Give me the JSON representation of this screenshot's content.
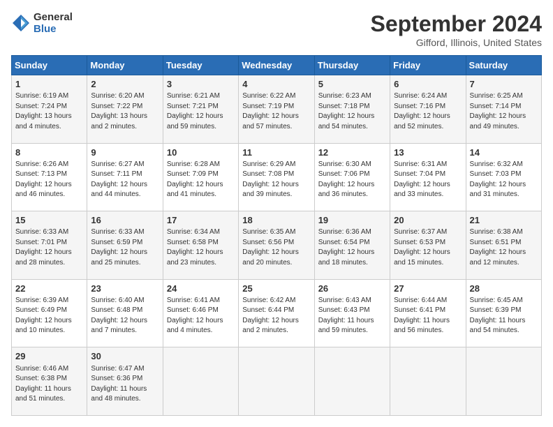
{
  "header": {
    "logo_line1": "General",
    "logo_line2": "Blue",
    "main_title": "September 2024",
    "subtitle": "Gifford, Illinois, United States"
  },
  "columns": [
    "Sunday",
    "Monday",
    "Tuesday",
    "Wednesday",
    "Thursday",
    "Friday",
    "Saturday"
  ],
  "weeks": [
    [
      {
        "day": "1",
        "info": "Sunrise: 6:19 AM\nSunset: 7:24 PM\nDaylight: 13 hours\nand 4 minutes."
      },
      {
        "day": "2",
        "info": "Sunrise: 6:20 AM\nSunset: 7:22 PM\nDaylight: 13 hours\nand 2 minutes."
      },
      {
        "day": "3",
        "info": "Sunrise: 6:21 AM\nSunset: 7:21 PM\nDaylight: 12 hours\nand 59 minutes."
      },
      {
        "day": "4",
        "info": "Sunrise: 6:22 AM\nSunset: 7:19 PM\nDaylight: 12 hours\nand 57 minutes."
      },
      {
        "day": "5",
        "info": "Sunrise: 6:23 AM\nSunset: 7:18 PM\nDaylight: 12 hours\nand 54 minutes."
      },
      {
        "day": "6",
        "info": "Sunrise: 6:24 AM\nSunset: 7:16 PM\nDaylight: 12 hours\nand 52 minutes."
      },
      {
        "day": "7",
        "info": "Sunrise: 6:25 AM\nSunset: 7:14 PM\nDaylight: 12 hours\nand 49 minutes."
      }
    ],
    [
      {
        "day": "8",
        "info": "Sunrise: 6:26 AM\nSunset: 7:13 PM\nDaylight: 12 hours\nand 46 minutes."
      },
      {
        "day": "9",
        "info": "Sunrise: 6:27 AM\nSunset: 7:11 PM\nDaylight: 12 hours\nand 44 minutes."
      },
      {
        "day": "10",
        "info": "Sunrise: 6:28 AM\nSunset: 7:09 PM\nDaylight: 12 hours\nand 41 minutes."
      },
      {
        "day": "11",
        "info": "Sunrise: 6:29 AM\nSunset: 7:08 PM\nDaylight: 12 hours\nand 39 minutes."
      },
      {
        "day": "12",
        "info": "Sunrise: 6:30 AM\nSunset: 7:06 PM\nDaylight: 12 hours\nand 36 minutes."
      },
      {
        "day": "13",
        "info": "Sunrise: 6:31 AM\nSunset: 7:04 PM\nDaylight: 12 hours\nand 33 minutes."
      },
      {
        "day": "14",
        "info": "Sunrise: 6:32 AM\nSunset: 7:03 PM\nDaylight: 12 hours\nand 31 minutes."
      }
    ],
    [
      {
        "day": "15",
        "info": "Sunrise: 6:33 AM\nSunset: 7:01 PM\nDaylight: 12 hours\nand 28 minutes."
      },
      {
        "day": "16",
        "info": "Sunrise: 6:33 AM\nSunset: 6:59 PM\nDaylight: 12 hours\nand 25 minutes."
      },
      {
        "day": "17",
        "info": "Sunrise: 6:34 AM\nSunset: 6:58 PM\nDaylight: 12 hours\nand 23 minutes."
      },
      {
        "day": "18",
        "info": "Sunrise: 6:35 AM\nSunset: 6:56 PM\nDaylight: 12 hours\nand 20 minutes."
      },
      {
        "day": "19",
        "info": "Sunrise: 6:36 AM\nSunset: 6:54 PM\nDaylight: 12 hours\nand 18 minutes."
      },
      {
        "day": "20",
        "info": "Sunrise: 6:37 AM\nSunset: 6:53 PM\nDaylight: 12 hours\nand 15 minutes."
      },
      {
        "day": "21",
        "info": "Sunrise: 6:38 AM\nSunset: 6:51 PM\nDaylight: 12 hours\nand 12 minutes."
      }
    ],
    [
      {
        "day": "22",
        "info": "Sunrise: 6:39 AM\nSunset: 6:49 PM\nDaylight: 12 hours\nand 10 minutes."
      },
      {
        "day": "23",
        "info": "Sunrise: 6:40 AM\nSunset: 6:48 PM\nDaylight: 12 hours\nand 7 minutes."
      },
      {
        "day": "24",
        "info": "Sunrise: 6:41 AM\nSunset: 6:46 PM\nDaylight: 12 hours\nand 4 minutes."
      },
      {
        "day": "25",
        "info": "Sunrise: 6:42 AM\nSunset: 6:44 PM\nDaylight: 12 hours\nand 2 minutes."
      },
      {
        "day": "26",
        "info": "Sunrise: 6:43 AM\nSunset: 6:43 PM\nDaylight: 11 hours\nand 59 minutes."
      },
      {
        "day": "27",
        "info": "Sunrise: 6:44 AM\nSunset: 6:41 PM\nDaylight: 11 hours\nand 56 minutes."
      },
      {
        "day": "28",
        "info": "Sunrise: 6:45 AM\nSunset: 6:39 PM\nDaylight: 11 hours\nand 54 minutes."
      }
    ],
    [
      {
        "day": "29",
        "info": "Sunrise: 6:46 AM\nSunset: 6:38 PM\nDaylight: 11 hours\nand 51 minutes."
      },
      {
        "day": "30",
        "info": "Sunrise: 6:47 AM\nSunset: 6:36 PM\nDaylight: 11 hours\nand 48 minutes."
      },
      {
        "day": "",
        "info": ""
      },
      {
        "day": "",
        "info": ""
      },
      {
        "day": "",
        "info": ""
      },
      {
        "day": "",
        "info": ""
      },
      {
        "day": "",
        "info": ""
      }
    ]
  ]
}
